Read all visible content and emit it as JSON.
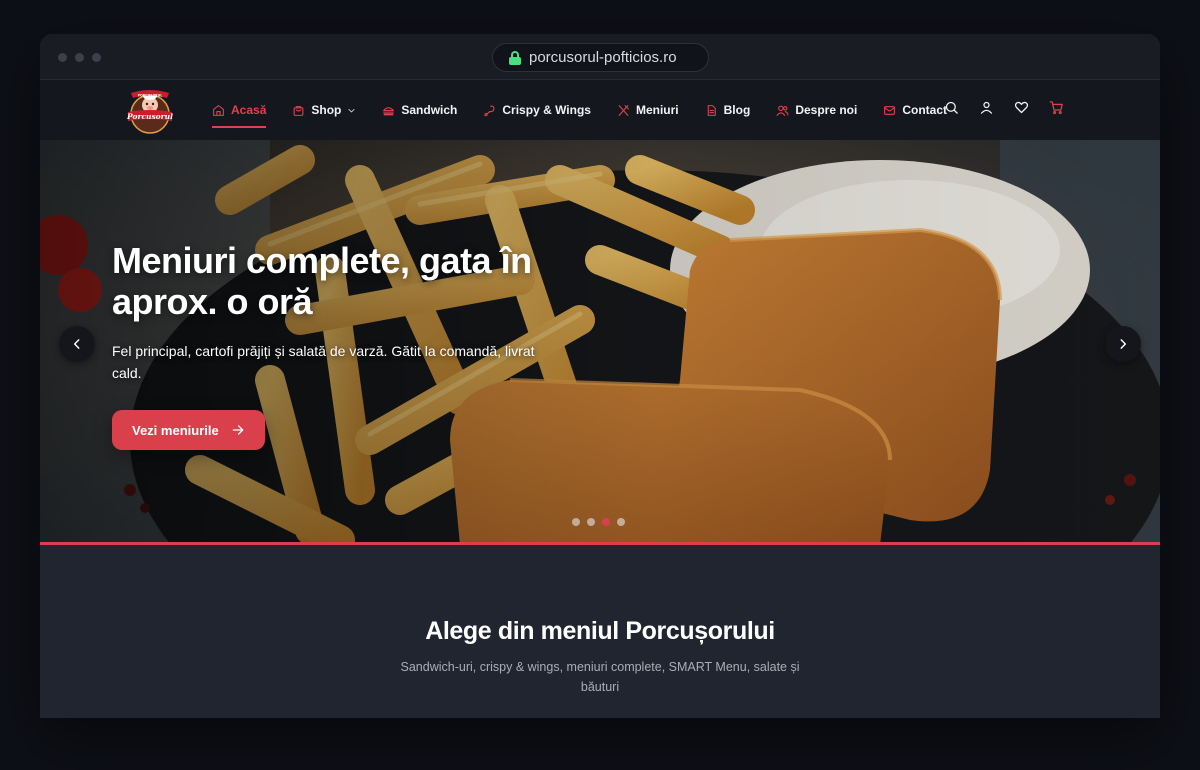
{
  "browser": {
    "url": "porcusorul-pofticios.ro"
  },
  "logo": {
    "top_text": "PORCUSORUL",
    "name": "Porcusorul"
  },
  "nav": {
    "items": [
      {
        "label": "Acasă"
      },
      {
        "label": "Shop"
      },
      {
        "label": "Sandwich"
      },
      {
        "label": "Crispy & Wings"
      },
      {
        "label": "Meniuri"
      },
      {
        "label": "Blog"
      },
      {
        "label": "Despre noi"
      },
      {
        "label": "Contact"
      }
    ]
  },
  "hero": {
    "title": "Meniuri complete, gata în aprox. o oră",
    "subtitle": "Fel principal, cartofi prăjiți și salată de varză. Gătit la comandă, livrat cald.",
    "button": "Vezi meniurile",
    "slides_total": 4,
    "active_slide": 3
  },
  "section": {
    "title": "Alege din meniul Porcușorului",
    "subtitle": "Sandwich-uri, crispy & wings, meniuri complete, SMART Menu, salate și băuturi"
  },
  "colors": {
    "accent": "#d9404b",
    "nav_bg": "#15171e",
    "section_bg": "#21252f"
  }
}
